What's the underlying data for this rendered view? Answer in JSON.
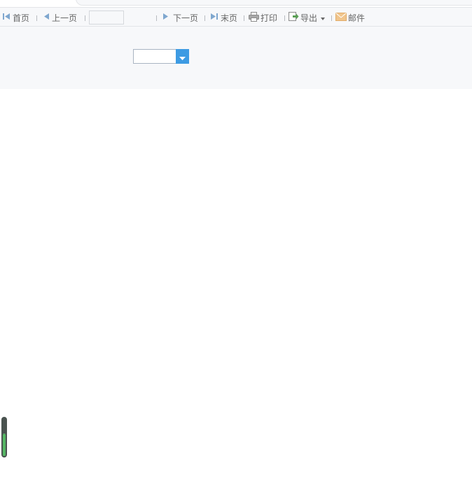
{
  "toolbar": {
    "first_page": "首页",
    "prev_page": "上一页",
    "page_input_value": "",
    "page_input_placeholder": "",
    "page_total": "",
    "next_page": "下一页",
    "last_page": "末页",
    "print": "打印",
    "export": "导出",
    "mail": "邮件"
  },
  "parameter_panel": {
    "combo_value": ""
  },
  "loading_indicator": {
    "progress": 0.6
  },
  "colors": {
    "accent": "#3d9be3",
    "nav_arrow": "#7fa7cf",
    "export_icon": "#5aa055",
    "mail_icon": "#f0c58c",
    "progress_green": "#4fb85e"
  }
}
